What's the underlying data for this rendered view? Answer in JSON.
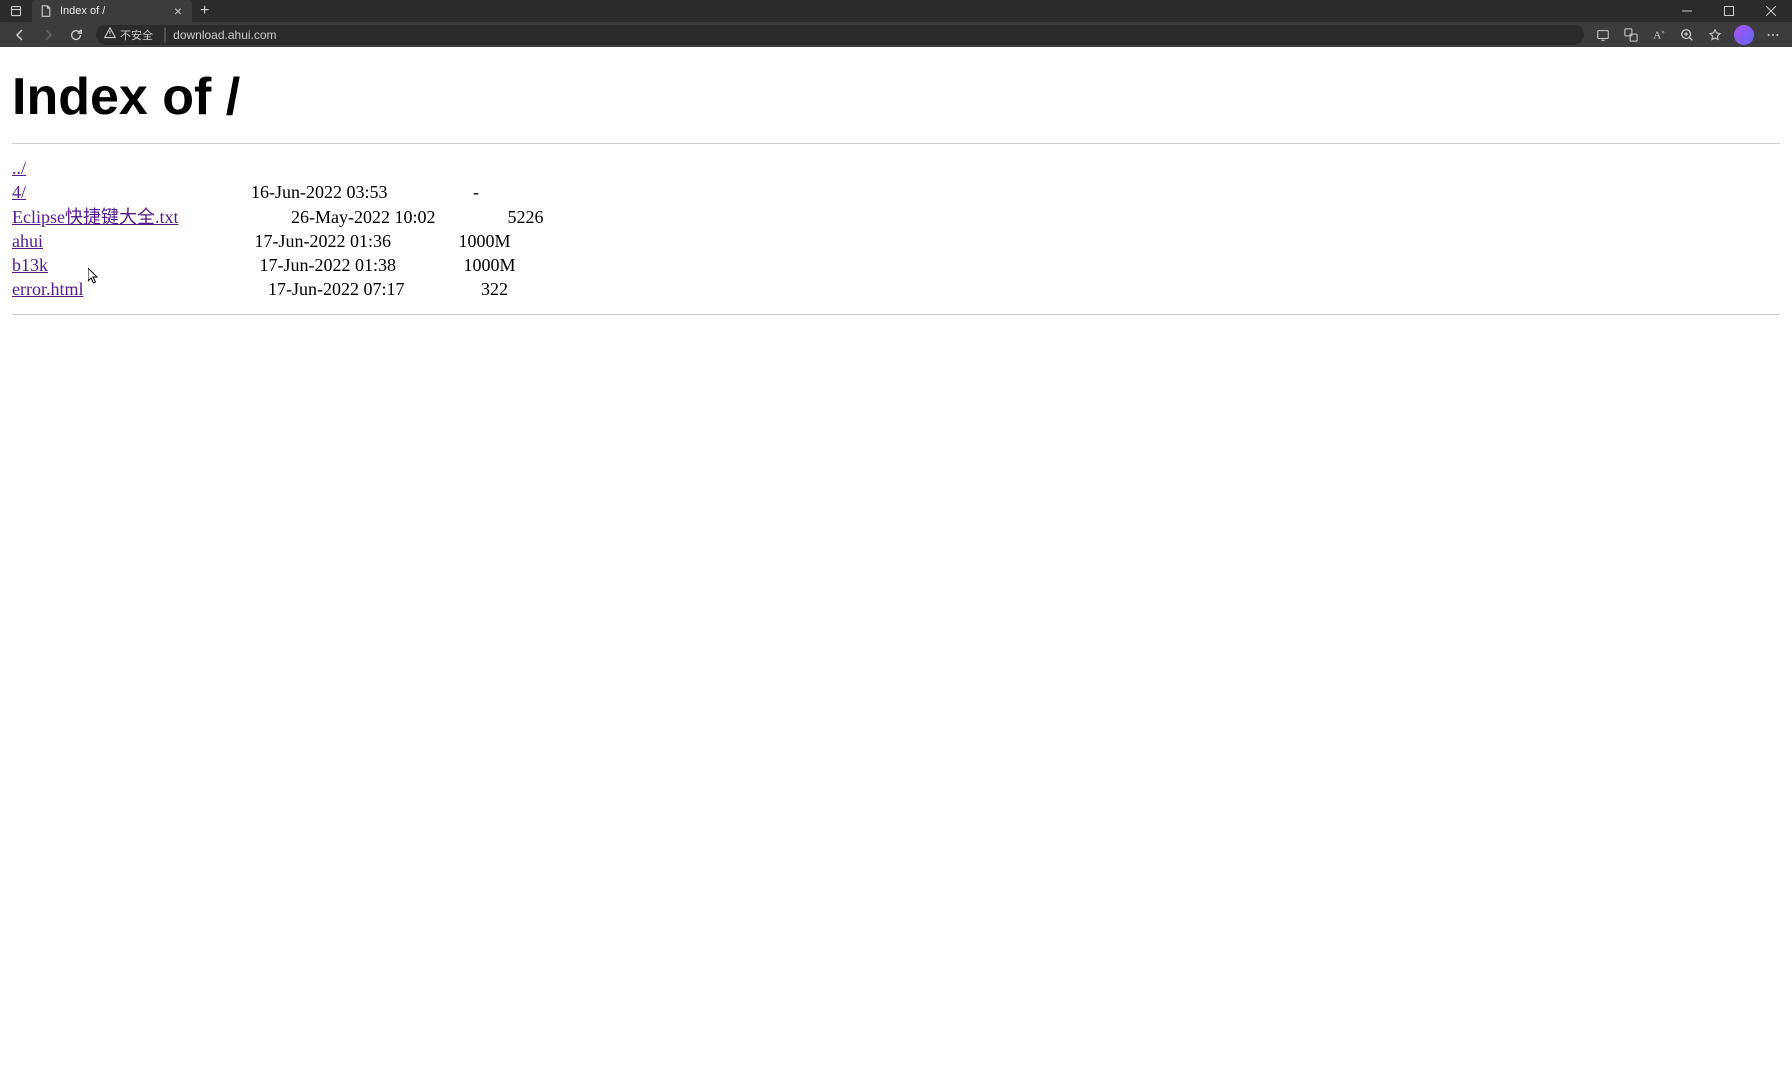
{
  "browser": {
    "tab_title": "Index of /",
    "security_label": "不安全",
    "url": "download.ahui.com"
  },
  "page": {
    "heading": "Index of /",
    "parent_link": "../",
    "entries": [
      {
        "name": "4/",
        "pad_cols": 50,
        "date": "16-Jun-2022 03:53",
        "size": "-"
      },
      {
        "name": "Eclipse快捷键大全.txt",
        "pad_cols": 25,
        "date": "26-May-2022 10:02",
        "size": "5226"
      },
      {
        "name": "ahui",
        "pad_cols": 47,
        "date": "17-Jun-2022 01:36",
        "size": "1000M"
      },
      {
        "name": "b13k",
        "pad_cols": 47,
        "date": "17-Jun-2022 01:38",
        "size": "1000M"
      },
      {
        "name": "error.html",
        "pad_cols": 41,
        "date": "17-Jun-2022 07:17",
        "size": "322"
      }
    ]
  }
}
